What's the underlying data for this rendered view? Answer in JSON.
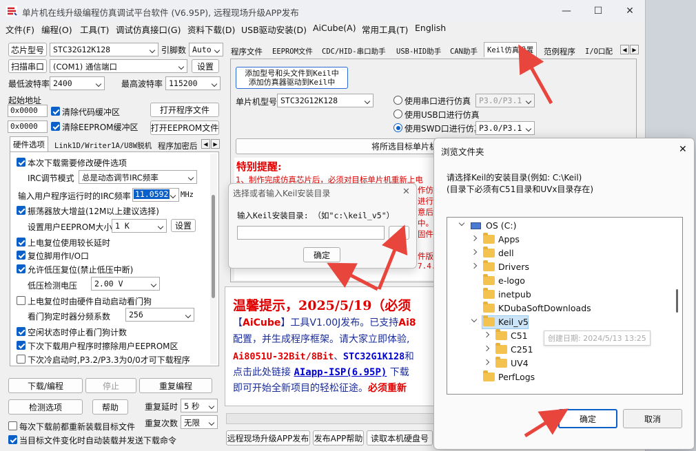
{
  "window": {
    "title": "单片机在线升级编程仿真调试平台软件 (V6.95P), 远程现场升级APP发布",
    "min_label": "—",
    "max_label": "☐",
    "close_label": "✕"
  },
  "menu": [
    "文件(F)",
    "编程(O)",
    "工具(T)",
    "调试仿真接口(G)",
    "资料下载(D)",
    "USB驱动安装(D)",
    "AiCube(A)",
    "常用工具(T)",
    "English"
  ],
  "left": {
    "chip_model_btn": "芯片型号",
    "chip_model_value": "STC32G12K128",
    "pin_count_label": "引脚数",
    "pin_count_value": "Auto",
    "scan_port_btn": "扫描串口",
    "port_value": "(COM1) 通信端口",
    "settings_btn": "设置",
    "min_baud_label": "最低波特率",
    "min_baud_value": "2400",
    "max_baud_label": "最高波特率",
    "max_baud_value": "115200",
    "start_addr_label": "起始地址",
    "addr1": "0x0000",
    "clear_code_label": "清除代码缓冲区",
    "open_prog_btn": "打开程序文件",
    "addr2": "0x0000",
    "clear_eeprom_label": "清除EEPROM缓冲区",
    "open_eeprom_btn": "打开EEPROM文件",
    "tabs": [
      "硬件选项",
      "Link1D/Writer1A/U8W脱机",
      "程序加密后"
    ],
    "hw": {
      "opt1": "本次下载需要修改硬件选项",
      "irc_mode_label": "IRC调节模式",
      "irc_mode_value": "总是动态调节IRC频率",
      "irc_freq_label": "输入用户程序运行时的IRC频率",
      "irc_freq_value": "11.0592",
      "irc_freq_unit": "MHz",
      "opt2": "振荡器放大增益(12M以上建议选择)",
      "eeprom_size_label": "设置用户EEPROM大小",
      "eeprom_size_value": "1  K",
      "eeprom_set_btn": "设置",
      "opt3": "上电复位使用较长延时",
      "opt4": "复位脚用作I/O口",
      "opt5": "允许低压复位(禁止低压中断)",
      "lv_label": "低压检测电压",
      "lv_value": "2.00 V",
      "opt6": "上电复位时由硬件自动启动看门狗",
      "wdt_label": "看门狗定时器分频系数",
      "wdt_value": "256",
      "opt7": "空闲状态时停止看门狗计数",
      "opt8": "下次下载用户程序时擦除用户EEPROM区",
      "opt9": "下次冷启动时,P3.2/P3.3为0/0才可下载程序"
    },
    "download_btn": "下载/编程",
    "stop_btn": "停止",
    "reprogram_btn": "重复编程",
    "check_btn": "检测选项",
    "help_btn": "帮助",
    "repeat_delay_label": "重复延时",
    "repeat_delay_value": "5 秒",
    "repeat_count_label": "重复次数",
    "repeat_count_value": "无限",
    "reload_label": "每次下载前都重新装载目标文件",
    "auto_label": "当目标文件变化时自动装载并发送下载命令"
  },
  "right": {
    "tabs": [
      "程序文件",
      "EEPROM文件",
      "CDC/HID-串口助手",
      "USB-HID助手",
      "CAN助手",
      "Keil仿真设置",
      "范例程序",
      "I/O口配"
    ],
    "add_model_btn_l1": "添加型号和头文件到Keil中",
    "add_model_btn_l2": "添加仿真器驱动到Keil中",
    "mcu_model_label": "单片机型号",
    "mcu_model_value": "STC32G12K128",
    "radio1_label": "使用串口进行仿真",
    "radio1_value": "P3.0/P3.1",
    "radio2_label": "使用USB口进行仿真",
    "radio3_label": "使用SWD口进行仿真",
    "radio3_value": "P3.0/P3.1",
    "set_chip_btn": "将所选目标单片机",
    "notice_title": "特别提醒:",
    "notice_line1": "1、制作完成仿真芯片后，必须对目标单片机重新上电",
    "notice_frag1": "作仿",
    "notice_frag2": "进行",
    "notice_frag3": "意后",
    "notice_frag4": "中。",
    "notice_frag5": "固件",
    "notice_frag6": "件版",
    "notice_frag7": "7.4.",
    "tip_title": "温馨提示，2025/5/19（必须",
    "tip_p1a": "【",
    "tip_p1b": "AiCube",
    "tip_p1c": "】工具V1.00J发布。已支持",
    "tip_p1d": "Ai8",
    "tip_p2": "配置，并生成程序框架。请大家立即体验,",
    "tip_p3a": "Ai8051U-32Bit/8Bit",
    "tip_p3b": "、",
    "tip_p3c": "STC32G1K128",
    "tip_p3d": "和",
    "tip_p4a": "点击此处链接 ",
    "tip_p4b": "AIapp-ISP(6.95P)",
    "tip_p4c": " 下载",
    "tip_p5a": "即可开始全新项目的轻松征途。",
    "tip_p5b": "必须重新",
    "bottom_btns": [
      "远程现场升级APP发布",
      "发布APP帮助",
      "读取本机硬盘号"
    ]
  },
  "keil_dialog": {
    "title": "选择或者输入Keil安装目录",
    "close": "✕",
    "prompt": "输入Keil安装目录: （如\"c:\\keil_v5\"）",
    "path_value": "",
    "browse_btn": "...",
    "ok_btn": "确定"
  },
  "folder_dialog": {
    "title": "浏览文件夹",
    "close": "✕",
    "instr1": "请选择Keil的安装目录(例如: C:\\Keil)",
    "instr2": "(目录下必须有C51目录和UVx目录存在)",
    "tree": [
      {
        "label": "OS (C:)",
        "type": "drive",
        "state": "open",
        "level": 0
      },
      {
        "label": "Apps",
        "state": "closed",
        "level": 1
      },
      {
        "label": "dell",
        "state": "closed",
        "level": 1
      },
      {
        "label": "Drivers",
        "state": "closed",
        "level": 1
      },
      {
        "label": "e-logo",
        "state": "none",
        "level": 1
      },
      {
        "label": "inetpub",
        "state": "none",
        "level": 1
      },
      {
        "label": "KDubaSoftDownloads",
        "state": "none",
        "level": 1
      },
      {
        "label": "Keil_v5",
        "state": "open",
        "level": 1,
        "selected": true
      },
      {
        "label": "C51",
        "state": "closed",
        "level": 2
      },
      {
        "label": "C251",
        "state": "closed",
        "level": 2
      },
      {
        "label": "UV4",
        "state": "closed",
        "level": 2
      },
      {
        "label": "PerfLogs",
        "state": "none",
        "level": 1
      }
    ],
    "tooltip": "创建日期: 2024/5/13 13:25",
    "ok_btn": "确定",
    "cancel_btn": "取消"
  },
  "colors": {
    "annotation_arrow": "#e8453c",
    "accent": "#0a60c8",
    "notice_red": "#e00000"
  }
}
